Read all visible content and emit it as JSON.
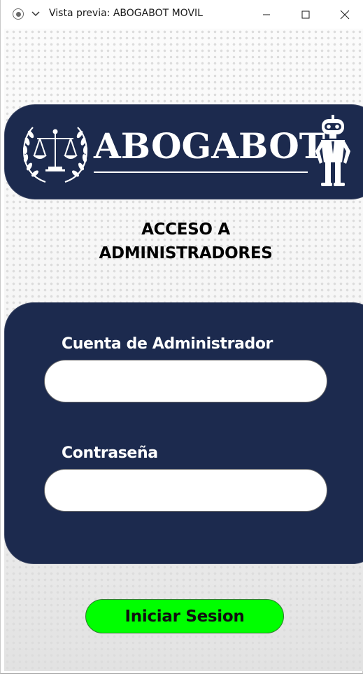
{
  "window": {
    "title": "Vista previa: ABOGABOT MOVIL"
  },
  "banner": {
    "brand": "ABOGABOT",
    "logo_icon": "scales-of-justice-icon",
    "mascot_icon": "robot-icon"
  },
  "heading": {
    "line1": "ACCESO A",
    "line2": "ADMINISTRADORES"
  },
  "form": {
    "account_label": "Cuenta de Administrador",
    "account_value": "",
    "password_label": "Contraseña",
    "password_value": ""
  },
  "login_button": {
    "label": "Iniciar Sesion"
  },
  "colors": {
    "navy": "#1c2a4e",
    "button_green": "#00ff00"
  }
}
